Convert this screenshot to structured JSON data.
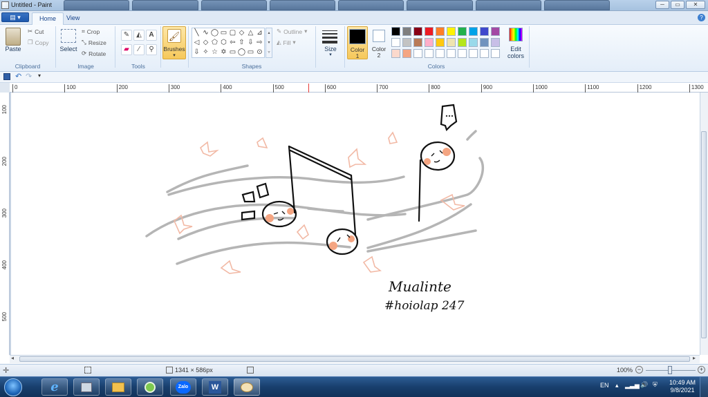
{
  "window": {
    "title": "Untitled - Paint",
    "controls": {
      "minimize": "─",
      "maximize": "▭",
      "close": "✕"
    }
  },
  "menu": {
    "file_label": "▤ ▾",
    "tabs": [
      "Home",
      "View"
    ],
    "help": "?"
  },
  "ribbon": {
    "clipboard": {
      "paste": "Paste",
      "cut": "Cut",
      "copy": "Copy",
      "label": "Clipboard"
    },
    "image": {
      "select": "Select",
      "crop": "Crop",
      "resize": "Resize",
      "rotate": "Rotate",
      "label": "Image"
    },
    "tools": {
      "label": "Tools"
    },
    "brushes": {
      "label": "Brushes"
    },
    "shapes": {
      "outline": "Outline",
      "fill": "Fill",
      "label": "Shapes",
      "glyphs": [
        "╲",
        "∿",
        "◯",
        "▭",
        "▢",
        "◇",
        "△",
        "⊿",
        "◁",
        "◇",
        "⬠",
        "⬡",
        "⇦",
        "⇧",
        "⇩",
        "⇨",
        "⇩",
        "✧",
        "☆",
        "✡",
        "▭",
        "◯",
        "▭",
        "⊙"
      ]
    },
    "size": {
      "label": "Size"
    },
    "colors": {
      "color1_label": "Color",
      "color1_num": "1",
      "color2_label": "Color",
      "color2_num": "2",
      "edit_label": "Edit colors",
      "label": "Colors",
      "color1": "#000000",
      "color2": "#ffffff",
      "palette": [
        "#000000",
        "#7f7f7f",
        "#880015",
        "#ed1c24",
        "#ff7f27",
        "#fff200",
        "#22b14c",
        "#00a2e8",
        "#3f48cc",
        "#a349a4",
        "#ffffff",
        "#c3c3c3",
        "#b97a57",
        "#ffaec9",
        "#ffc90e",
        "#efe4b0",
        "#b5e61d",
        "#99d9ea",
        "#7092be",
        "#c8bfe7",
        "#fbd9cc",
        "#f4a582",
        "#ffffff",
        "#ffffff",
        "#ffffff",
        "#ffffff",
        "#ffffff",
        "#ffffff",
        "#ffffff",
        "#ffffff"
      ]
    }
  },
  "ruler": {
    "h": [
      "0",
      "100",
      "200",
      "300",
      "400",
      "500",
      "600",
      "700",
      "800",
      "900",
      "1000",
      "1100",
      "1200",
      "1300"
    ],
    "v": [
      "100",
      "200",
      "300",
      "400",
      "500"
    ]
  },
  "canvas": {
    "text1": "Mualinte",
    "text2": "#hoiolap 247"
  },
  "status": {
    "size": "1341 × 586px",
    "zoom": "100%"
  },
  "taskbar": {
    "lang": "EN",
    "time": "10:49 AM",
    "date": "9/8/2021",
    "zalo": "Zalo",
    "word": "W"
  }
}
